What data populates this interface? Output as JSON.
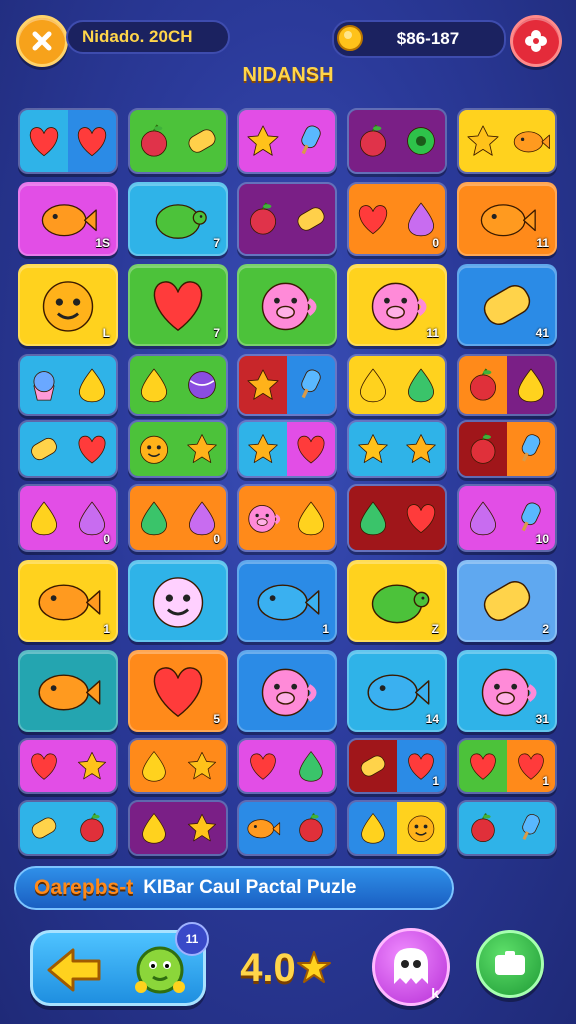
{
  "header": {
    "title": "Nidado. 20CH",
    "coins": "$86-187",
    "heading": "NIDANSH"
  },
  "banner": {
    "part1": "Oarepbs-t",
    "part2": "KIBar Caul Pactal Puzle"
  },
  "bottom": {
    "badge": "11",
    "score": "4.0",
    "pink_button_label": "k"
  },
  "colors": {
    "blue": "#2b8be6",
    "green": "#4cc23a",
    "pink": "#e24ee6",
    "purple": "#7a1f86",
    "yellow": "#ffd21e",
    "orange": "#ff8a1a",
    "red": "#c8262a",
    "cyan": "#2fb3e8",
    "teal": "#24a5b0",
    "magenta": "#d53ecf",
    "darkred": "#a0161a",
    "lightblue": "#5fa8f0"
  },
  "rows": [
    {
      "tiles": [
        {
          "left": "cyan",
          "right": "blue",
          "icons": [
            "heart-icon",
            "heart-icon"
          ],
          "num": ""
        },
        {
          "left": "green",
          "right": "green",
          "icons": [
            "apple-icon",
            "corn-icon"
          ],
          "num": ""
        },
        {
          "left": "pink",
          "right": "pink",
          "icons": [
            "flower-icon",
            "popsicle-icon"
          ],
          "num": ""
        },
        {
          "left": "purple",
          "right": "purple",
          "icons": [
            "apple-icon",
            "donut-icon"
          ],
          "num": ""
        },
        {
          "left": "yellow",
          "right": "yellow",
          "icons": [
            "flower-icon",
            "fish-icon"
          ],
          "num": ""
        }
      ]
    },
    {
      "tiles": [
        {
          "bg": "pink",
          "icon": "fish-icon",
          "num": "1S"
        },
        {
          "bg": "cyan",
          "icon": "turtle-icon",
          "num": "7"
        },
        {
          "left": "purple",
          "right": "purple",
          "icons": [
            "apple-icon",
            "corn-icon"
          ],
          "num": ""
        },
        {
          "left": "orange",
          "right": "orange",
          "icons": [
            "heart-icon",
            "egg-icon"
          ],
          "num": "0"
        },
        {
          "bg": "orange",
          "icon": "fish-icon",
          "num": "11"
        }
      ]
    },
    {
      "tiles": [
        {
          "bg": "yellow",
          "icon": "face-icon",
          "num": "L"
        },
        {
          "bg": "green",
          "icon": "heart-icon",
          "num": "7"
        },
        {
          "bg": "green",
          "icon": "pig-icon",
          "num": ""
        },
        {
          "bg": "yellow",
          "icon": "pig-icon",
          "num": "11"
        },
        {
          "bg": "blue",
          "icon": "candy-icon",
          "num": "41"
        }
      ]
    },
    {
      "tiles": [
        {
          "left": "cyan",
          "right": "cyan",
          "icons": [
            "cupcake-icon",
            "drop-icon"
          ],
          "num": ""
        },
        {
          "left": "green",
          "right": "green",
          "icons": [
            "drop-icon",
            "ball-icon"
          ],
          "num": ""
        },
        {
          "left": "red",
          "right": "blue",
          "icons": [
            "bell-icon",
            "popsicle-icon"
          ],
          "num": ""
        },
        {
          "left": "yellow",
          "right": "yellow",
          "icons": [
            "drop-icon",
            "balloon-icon"
          ],
          "num": ""
        },
        {
          "left": "orange",
          "right": "purple",
          "icons": [
            "strawberry-icon",
            "drop-icon"
          ],
          "num": ""
        }
      ]
    },
    {
      "tiles": [
        {
          "left": "cyan",
          "right": "cyan",
          "icons": [
            "candy-icon",
            "heart-icon"
          ],
          "num": ""
        },
        {
          "left": "green",
          "right": "green",
          "icons": [
            "face-icon",
            "bell-icon"
          ],
          "num": ""
        },
        {
          "left": "cyan",
          "right": "pink",
          "icons": [
            "bell-icon",
            "heart-icon"
          ],
          "num": ""
        },
        {
          "left": "cyan",
          "right": "cyan",
          "icons": [
            "flower-icon",
            "bell-icon"
          ],
          "num": ""
        },
        {
          "left": "darkred",
          "right": "orange",
          "icons": [
            "strawberry-icon",
            "popsicle-icon"
          ],
          "num": ""
        }
      ]
    },
    {
      "tiles": [
        {
          "left": "pink",
          "right": "pink",
          "icons": [
            "drop-icon",
            "egg-icon"
          ],
          "num": "0"
        },
        {
          "left": "orange",
          "right": "orange",
          "icons": [
            "balloon-icon",
            "egg-icon"
          ],
          "num": "0"
        },
        {
          "left": "orange",
          "right": "orange",
          "icons": [
            "pig-icon",
            "drop-icon"
          ],
          "num": ""
        },
        {
          "left": "darkred",
          "right": "darkred",
          "icons": [
            "balloon-icon",
            "heart-icon"
          ],
          "num": ""
        },
        {
          "left": "pink",
          "right": "pink",
          "icons": [
            "egg-icon",
            "popsicle-icon"
          ],
          "num": "10"
        }
      ]
    },
    {
      "tiles": [
        {
          "bg": "yellow",
          "icon": "fish-icon",
          "num": "1"
        },
        {
          "bg": "cyan",
          "icon": "ghost-icon",
          "num": ""
        },
        {
          "bg": "blue",
          "icon": "whale-icon",
          "num": "1"
        },
        {
          "bg": "yellow",
          "icon": "turtle-icon",
          "num": "Z"
        },
        {
          "bg": "lightblue",
          "icon": "candy-icon",
          "num": "2"
        }
      ]
    },
    {
      "tiles": [
        {
          "bg": "teal",
          "icon": "fish-icon",
          "num": ""
        },
        {
          "bg": "orange",
          "icon": "heart-icon",
          "num": "5"
        },
        {
          "bg": "blue",
          "icon": "pig-icon",
          "num": ""
        },
        {
          "bg": "cyan",
          "icon": "whale-icon",
          "num": "14"
        },
        {
          "bg": "cyan",
          "icon": "pig-icon",
          "num": "31"
        }
      ]
    },
    {
      "tiles": [
        {
          "left": "pink",
          "right": "pink",
          "icons": [
            "heart-icon",
            "flower-icon"
          ],
          "num": ""
        },
        {
          "left": "orange",
          "right": "orange",
          "icons": [
            "drop-icon",
            "flower-icon"
          ],
          "num": ""
        },
        {
          "left": "pink",
          "right": "pink",
          "icons": [
            "heart-icon",
            "balloon-icon"
          ],
          "num": ""
        },
        {
          "left": "darkred",
          "right": "blue",
          "icons": [
            "candy-icon",
            "heart-icon"
          ],
          "num": "1"
        },
        {
          "left": "green",
          "right": "orange",
          "icons": [
            "heart-icon",
            "heart-icon"
          ],
          "num": "1"
        }
      ]
    },
    {
      "tiles": [
        {
          "left": "cyan",
          "right": "cyan",
          "icons": [
            "candy-icon",
            "strawberry-icon"
          ],
          "num": ""
        },
        {
          "left": "purple",
          "right": "purple",
          "icons": [
            "drop-icon",
            "flower-icon"
          ],
          "num": ""
        },
        {
          "left": "blue",
          "right": "blue",
          "icons": [
            "fish-icon",
            "strawberry-icon"
          ],
          "num": ""
        },
        {
          "left": "blue",
          "right": "yellow",
          "icons": [
            "drop-icon",
            "face-icon"
          ],
          "num": ""
        },
        {
          "left": "cyan",
          "right": "cyan",
          "icons": [
            "strawberry-icon",
            "popsicle-icon"
          ],
          "num": ""
        }
      ]
    }
  ]
}
